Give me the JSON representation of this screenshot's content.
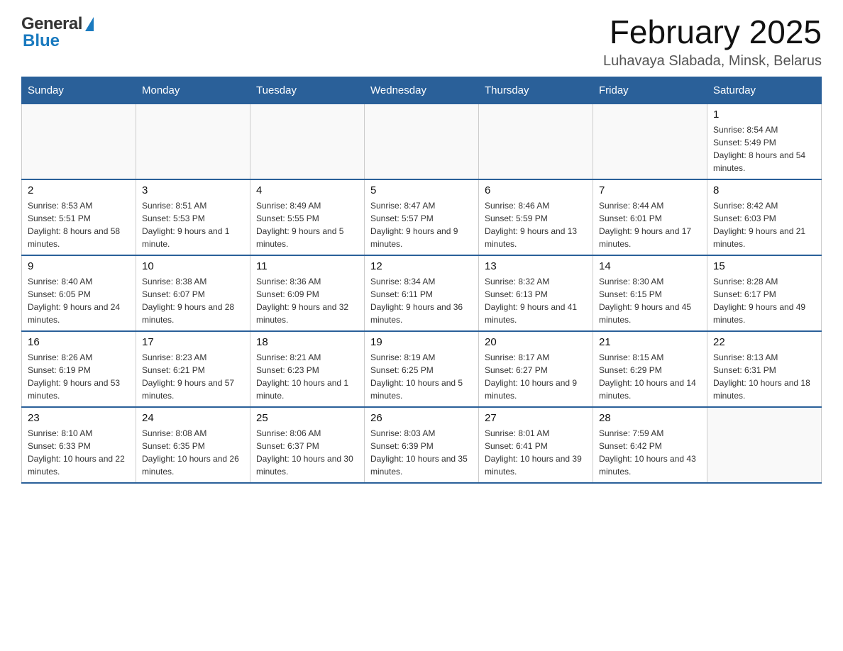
{
  "header": {
    "logo_general": "General",
    "logo_blue": "Blue",
    "month_title": "February 2025",
    "location": "Luhavaya Slabada, Minsk, Belarus"
  },
  "weekdays": [
    "Sunday",
    "Monday",
    "Tuesday",
    "Wednesday",
    "Thursday",
    "Friday",
    "Saturday"
  ],
  "weeks": [
    [
      {
        "day": "",
        "info": ""
      },
      {
        "day": "",
        "info": ""
      },
      {
        "day": "",
        "info": ""
      },
      {
        "day": "",
        "info": ""
      },
      {
        "day": "",
        "info": ""
      },
      {
        "day": "",
        "info": ""
      },
      {
        "day": "1",
        "info": "Sunrise: 8:54 AM\nSunset: 5:49 PM\nDaylight: 8 hours and 54 minutes."
      }
    ],
    [
      {
        "day": "2",
        "info": "Sunrise: 8:53 AM\nSunset: 5:51 PM\nDaylight: 8 hours and 58 minutes."
      },
      {
        "day": "3",
        "info": "Sunrise: 8:51 AM\nSunset: 5:53 PM\nDaylight: 9 hours and 1 minute."
      },
      {
        "day": "4",
        "info": "Sunrise: 8:49 AM\nSunset: 5:55 PM\nDaylight: 9 hours and 5 minutes."
      },
      {
        "day": "5",
        "info": "Sunrise: 8:47 AM\nSunset: 5:57 PM\nDaylight: 9 hours and 9 minutes."
      },
      {
        "day": "6",
        "info": "Sunrise: 8:46 AM\nSunset: 5:59 PM\nDaylight: 9 hours and 13 minutes."
      },
      {
        "day": "7",
        "info": "Sunrise: 8:44 AM\nSunset: 6:01 PM\nDaylight: 9 hours and 17 minutes."
      },
      {
        "day": "8",
        "info": "Sunrise: 8:42 AM\nSunset: 6:03 PM\nDaylight: 9 hours and 21 minutes."
      }
    ],
    [
      {
        "day": "9",
        "info": "Sunrise: 8:40 AM\nSunset: 6:05 PM\nDaylight: 9 hours and 24 minutes."
      },
      {
        "day": "10",
        "info": "Sunrise: 8:38 AM\nSunset: 6:07 PM\nDaylight: 9 hours and 28 minutes."
      },
      {
        "day": "11",
        "info": "Sunrise: 8:36 AM\nSunset: 6:09 PM\nDaylight: 9 hours and 32 minutes."
      },
      {
        "day": "12",
        "info": "Sunrise: 8:34 AM\nSunset: 6:11 PM\nDaylight: 9 hours and 36 minutes."
      },
      {
        "day": "13",
        "info": "Sunrise: 8:32 AM\nSunset: 6:13 PM\nDaylight: 9 hours and 41 minutes."
      },
      {
        "day": "14",
        "info": "Sunrise: 8:30 AM\nSunset: 6:15 PM\nDaylight: 9 hours and 45 minutes."
      },
      {
        "day": "15",
        "info": "Sunrise: 8:28 AM\nSunset: 6:17 PM\nDaylight: 9 hours and 49 minutes."
      }
    ],
    [
      {
        "day": "16",
        "info": "Sunrise: 8:26 AM\nSunset: 6:19 PM\nDaylight: 9 hours and 53 minutes."
      },
      {
        "day": "17",
        "info": "Sunrise: 8:23 AM\nSunset: 6:21 PM\nDaylight: 9 hours and 57 minutes."
      },
      {
        "day": "18",
        "info": "Sunrise: 8:21 AM\nSunset: 6:23 PM\nDaylight: 10 hours and 1 minute."
      },
      {
        "day": "19",
        "info": "Sunrise: 8:19 AM\nSunset: 6:25 PM\nDaylight: 10 hours and 5 minutes."
      },
      {
        "day": "20",
        "info": "Sunrise: 8:17 AM\nSunset: 6:27 PM\nDaylight: 10 hours and 9 minutes."
      },
      {
        "day": "21",
        "info": "Sunrise: 8:15 AM\nSunset: 6:29 PM\nDaylight: 10 hours and 14 minutes."
      },
      {
        "day": "22",
        "info": "Sunrise: 8:13 AM\nSunset: 6:31 PM\nDaylight: 10 hours and 18 minutes."
      }
    ],
    [
      {
        "day": "23",
        "info": "Sunrise: 8:10 AM\nSunset: 6:33 PM\nDaylight: 10 hours and 22 minutes."
      },
      {
        "day": "24",
        "info": "Sunrise: 8:08 AM\nSunset: 6:35 PM\nDaylight: 10 hours and 26 minutes."
      },
      {
        "day": "25",
        "info": "Sunrise: 8:06 AM\nSunset: 6:37 PM\nDaylight: 10 hours and 30 minutes."
      },
      {
        "day": "26",
        "info": "Sunrise: 8:03 AM\nSunset: 6:39 PM\nDaylight: 10 hours and 35 minutes."
      },
      {
        "day": "27",
        "info": "Sunrise: 8:01 AM\nSunset: 6:41 PM\nDaylight: 10 hours and 39 minutes."
      },
      {
        "day": "28",
        "info": "Sunrise: 7:59 AM\nSunset: 6:42 PM\nDaylight: 10 hours and 43 minutes."
      },
      {
        "day": "",
        "info": ""
      }
    ]
  ]
}
